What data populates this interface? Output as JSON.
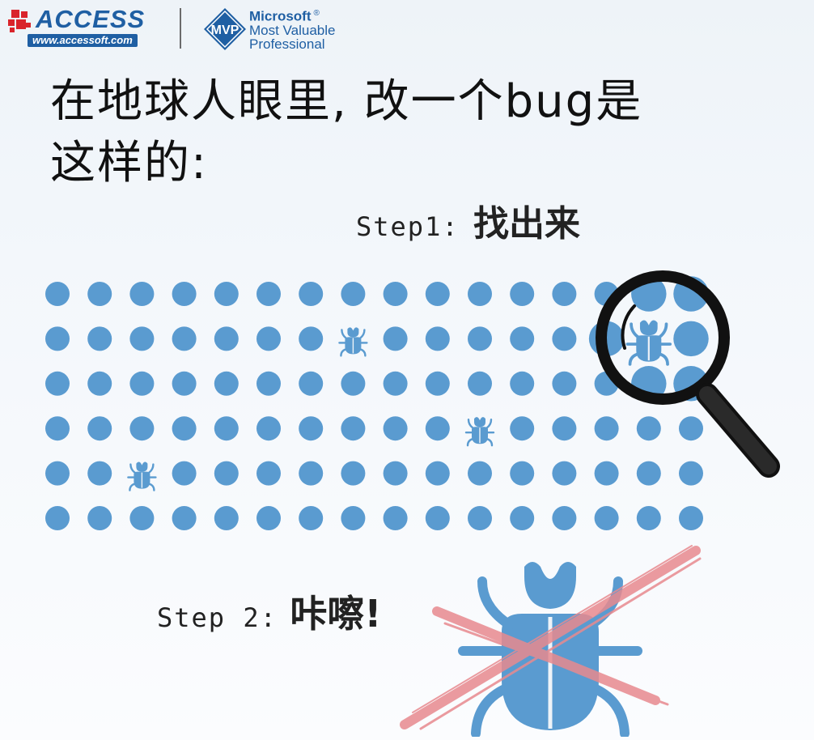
{
  "header": {
    "access_title": "ACCESS",
    "access_url": "www.accessoft.com",
    "mvp_badge": "MVP",
    "mvp_line1": "Microsoft",
    "mvp_reg": "®",
    "mvp_line2": "Most Valuable",
    "mvp_line3": "Professional"
  },
  "headline": {
    "line1": "在地球人眼里, 改一个bug是",
    "line2": "这样的:"
  },
  "step1": {
    "prefix": "Step1:",
    "action": "找出来"
  },
  "step2": {
    "prefix": "Step 2:",
    "action": "咔嚓!"
  },
  "colors": {
    "dot": "#5a9bd0",
    "bug": "#5a9bd0",
    "text": "#111111",
    "cross": "#e88a8f",
    "brand_blue": "#1f5fa3",
    "magnifier": "#111111"
  },
  "grid": {
    "rows": 6,
    "cols": 16,
    "bug_cells": [
      [
        1,
        7
      ],
      [
        3,
        10
      ],
      [
        4,
        2
      ],
      [
        1,
        14
      ]
    ]
  },
  "icons": {
    "access_logo": "access-logo-icon",
    "mvp_logo": "mvp-diamond-icon",
    "magnifier": "magnifying-glass-icon",
    "bug": "bug-icon",
    "cross": "cross-out-icon"
  }
}
